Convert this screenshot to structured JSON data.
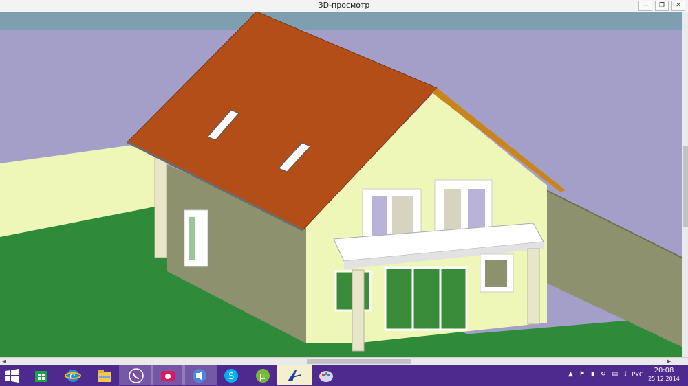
{
  "window": {
    "title": "3D-просмотр",
    "minimize_icon": "minimize-icon",
    "restore_icon": "restore-icon",
    "close_icon": "close-icon"
  },
  "scene": {
    "description_icon": "house-3d-model",
    "colors": {
      "sky": "#a39fc9",
      "horizon": "#7d9fb0",
      "ground": "#2f8a3a",
      "walls": "#eef6b8",
      "roof": "#b44e18"
    }
  },
  "taskbar": {
    "apps": [
      {
        "name": "store-icon"
      },
      {
        "name": "internet-explorer-icon"
      },
      {
        "name": "file-explorer-icon"
      },
      {
        "name": "viber-icon"
      },
      {
        "name": "camera-icon"
      },
      {
        "name": "media-player-icon"
      },
      {
        "name": "skype-icon"
      },
      {
        "name": "utorrent-icon"
      },
      {
        "name": "archicad-icon"
      },
      {
        "name": "paint-icon"
      }
    ],
    "language": "РУС",
    "time": "20:08",
    "date": "25.12.2014"
  }
}
